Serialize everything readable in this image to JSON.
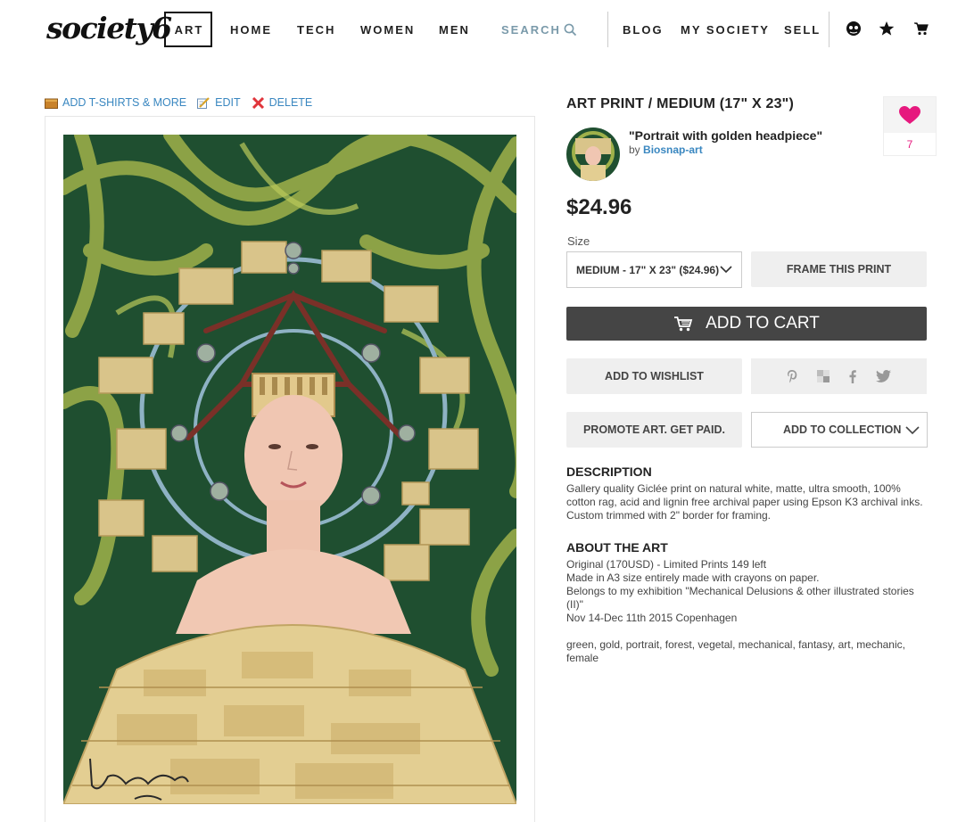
{
  "header": {
    "logo": "society6",
    "nav": [
      "ART",
      "HOME",
      "TECH",
      "WOMEN",
      "MEN"
    ],
    "search_label": "SEARCH",
    "nav_right": [
      "BLOG",
      "MY SOCIETY",
      "SELL"
    ],
    "icons": [
      "avatar-icon",
      "star-icon",
      "cart-icon"
    ]
  },
  "art_actions": {
    "add_label": "ADD T-SHIRTS & MORE",
    "edit_label": "EDIT",
    "delete_label": "DELETE"
  },
  "product": {
    "type": "ART PRINT / MEDIUM (17\" X 23\")",
    "title": "\"Portrait with golden headpiece\"",
    "by_prefix": "by",
    "artist": "Biosnap-art",
    "likes": "7",
    "price": "$24.96",
    "size_label": "Size",
    "size_value": "MEDIUM - 17\" X 23\" ($24.96)",
    "frame_label": "FRAME THIS PRINT",
    "cart_label": "ADD TO CART",
    "wishlist_label": "ADD TO WISHLIST",
    "share_icons": [
      "pinterest-icon",
      "tumblr-icon",
      "facebook-icon",
      "twitter-icon"
    ],
    "promote_label": "PROMOTE ART. GET PAID.",
    "collection_label": "ADD TO COLLECTION"
  },
  "description": {
    "heading": "DESCRIPTION",
    "text": "Gallery quality Giclée print on natural white, matte, ultra smooth, 100% cotton rag, acid and lignin free archival paper using Epson K3 archival inks. Custom trimmed with 2\" border for framing."
  },
  "about": {
    "heading": "ABOUT THE ART",
    "lines": [
      "Original (170USD) - Limited Prints 149 left",
      "Made in A3 size entirely made with crayons on paper.",
      "Belongs to my exhibition \"Mechanical Delusions & other illustrated stories (II)\"",
      "Nov 14-Dec 11th 2015 Copenhagen"
    ],
    "tags": "green, gold, portrait, forest, vegetal, mechanical, fantasy, art, mechanic, female"
  },
  "colors": {
    "link": "#3a87c0",
    "heart": "#e6197e",
    "cart_button": "#454545",
    "art_background": "#1f4f30",
    "art_vines": "#9fb14a",
    "art_gold": "#d9c48a"
  }
}
